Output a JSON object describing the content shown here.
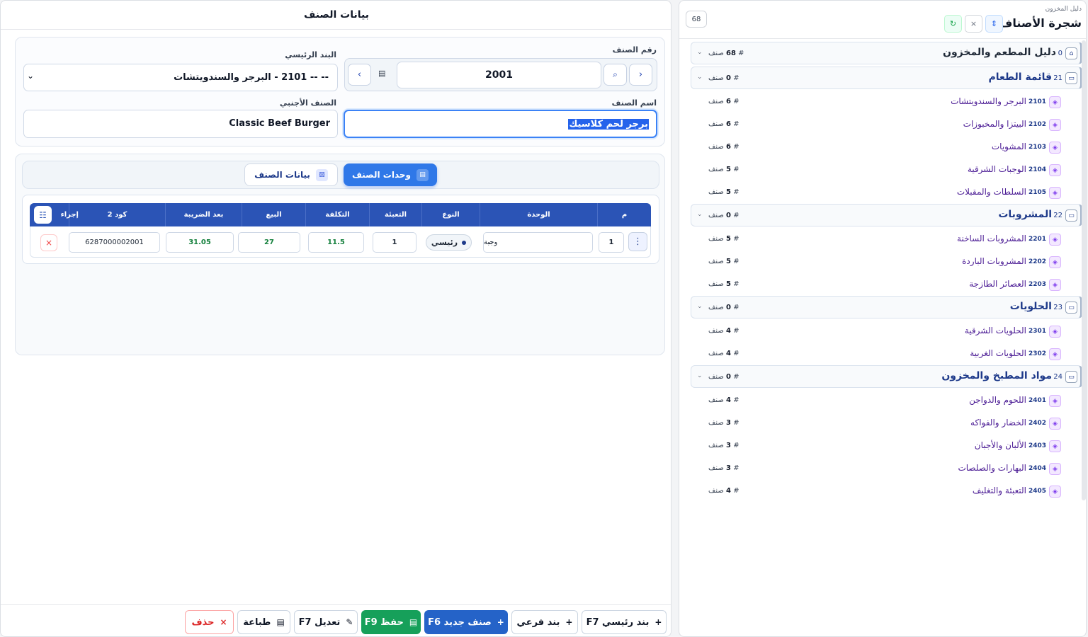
{
  "tree": {
    "subtitle": "دليل المخزون",
    "title": "شجرة الأصناف",
    "count": "68",
    "root": {
      "code": "0",
      "label": "دليل المطعم والمخزون",
      "count": "68",
      "unit": "صنف"
    },
    "groups": [
      {
        "code": "21",
        "label": "قائمة الطعام",
        "count": "0",
        "unit": "صنف",
        "children": [
          {
            "code": "2101",
            "label": "البرجر والسندويتشات",
            "count": "6",
            "unit": "صنف"
          },
          {
            "code": "2102",
            "label": "البيتزا والمخبوزات",
            "count": "6",
            "unit": "صنف"
          },
          {
            "code": "2103",
            "label": "المشويات",
            "count": "6",
            "unit": "صنف"
          },
          {
            "code": "2104",
            "label": "الوجبات الشرقية",
            "count": "5",
            "unit": "صنف"
          },
          {
            "code": "2105",
            "label": "السلطات والمقبلات",
            "count": "5",
            "unit": "صنف"
          }
        ]
      },
      {
        "code": "22",
        "label": "المشروبات",
        "count": "0",
        "unit": "صنف",
        "children": [
          {
            "code": "2201",
            "label": "المشروبات الساخنة",
            "count": "5",
            "unit": "صنف"
          },
          {
            "code": "2202",
            "label": "المشروبات الباردة",
            "count": "5",
            "unit": "صنف"
          },
          {
            "code": "2203",
            "label": "العصائر الطازجة",
            "count": "5",
            "unit": "صنف"
          }
        ]
      },
      {
        "code": "23",
        "label": "الحلويات",
        "count": "0",
        "unit": "صنف",
        "children": [
          {
            "code": "2301",
            "label": "الحلويات الشرقية",
            "count": "4",
            "unit": "صنف"
          },
          {
            "code": "2302",
            "label": "الحلويات الغربية",
            "count": "4",
            "unit": "صنف"
          }
        ]
      },
      {
        "code": "24",
        "label": "مواد المطبخ والمخزون",
        "count": "0",
        "unit": "صنف",
        "children": [
          {
            "code": "2401",
            "label": "اللحوم والدواجن",
            "count": "4",
            "unit": "صنف"
          },
          {
            "code": "2402",
            "label": "الخضار والفواكه",
            "count": "3",
            "unit": "صنف"
          },
          {
            "code": "2403",
            "label": "الألبان والأجبان",
            "count": "3",
            "unit": "صنف"
          },
          {
            "code": "2404",
            "label": "البهارات والصلصات",
            "count": "3",
            "unit": "صنف"
          },
          {
            "code": "2405",
            "label": "التعبئة والتغليف",
            "count": "4",
            "unit": "صنف"
          }
        ]
      }
    ]
  },
  "main": {
    "title": "بيانات الصنف",
    "form": {
      "item_number_label": "رقم الصنف",
      "item_number": "2001",
      "parent_label": "البند الرئيسي",
      "parent_value": "-- -- 2101 - البرجر والسندويتشات",
      "name_label": "اسم الصنف",
      "name_value": "برجر لحم كلاسيك",
      "foreign_label": "الصنف الأجنبي",
      "foreign_value": "Classic Beef Burger"
    },
    "tabs": {
      "units": "وحدات الصنف",
      "data": "بيانات الصنف"
    },
    "grid": {
      "headers": [
        "م",
        "الوحدة",
        "النوع",
        "التعبئة",
        "التكلفة",
        "البيع",
        "بعد الضريبة",
        "كود 2",
        "إجراء"
      ],
      "row": {
        "index": "1",
        "unit": "وجبة",
        "type": "رئيسي",
        "pack": "1",
        "cost": "11.5",
        "price": "27",
        "after_tax": "31.05",
        "code2": "6287000002001"
      }
    },
    "footer": {
      "main_item": "بند رئيسي F7",
      "sub_item": "بند فرعي",
      "new_item": "صنف جديد F6",
      "save": "حفظ F9",
      "edit": "تعديل F7",
      "print": "طباعة",
      "delete": "حذف"
    }
  }
}
